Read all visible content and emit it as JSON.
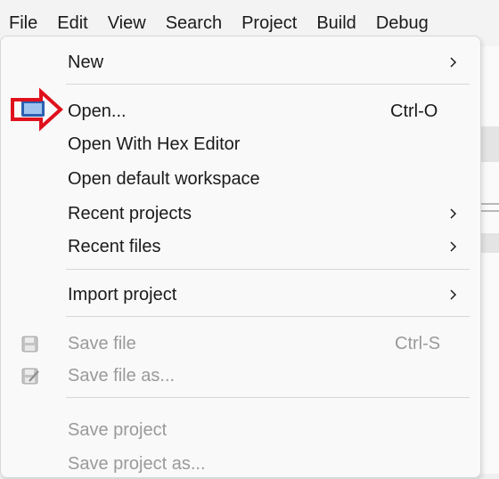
{
  "menubar": {
    "items": [
      "File",
      "Edit",
      "View",
      "Search",
      "Project",
      "Build",
      "Debug"
    ]
  },
  "file_menu": {
    "new": {
      "label": "New"
    },
    "open": {
      "label": "Open...",
      "shortcut": "Ctrl-O"
    },
    "open_hex": {
      "label": "Open With Hex Editor"
    },
    "open_workspace": {
      "label": "Open default workspace"
    },
    "recent_projects": {
      "label": "Recent projects"
    },
    "recent_files": {
      "label": "Recent files"
    },
    "import_project": {
      "label": "Import project"
    },
    "save_file": {
      "label": "Save file",
      "shortcut": "Ctrl-S"
    },
    "save_file_as": {
      "label": "Save file as..."
    },
    "save_project": {
      "label": "Save project"
    },
    "save_project_as": {
      "label": "Save project as..."
    }
  },
  "colors": {
    "annotation_arrow": "#e0101c",
    "disabled_text": "#9a9a9a"
  }
}
